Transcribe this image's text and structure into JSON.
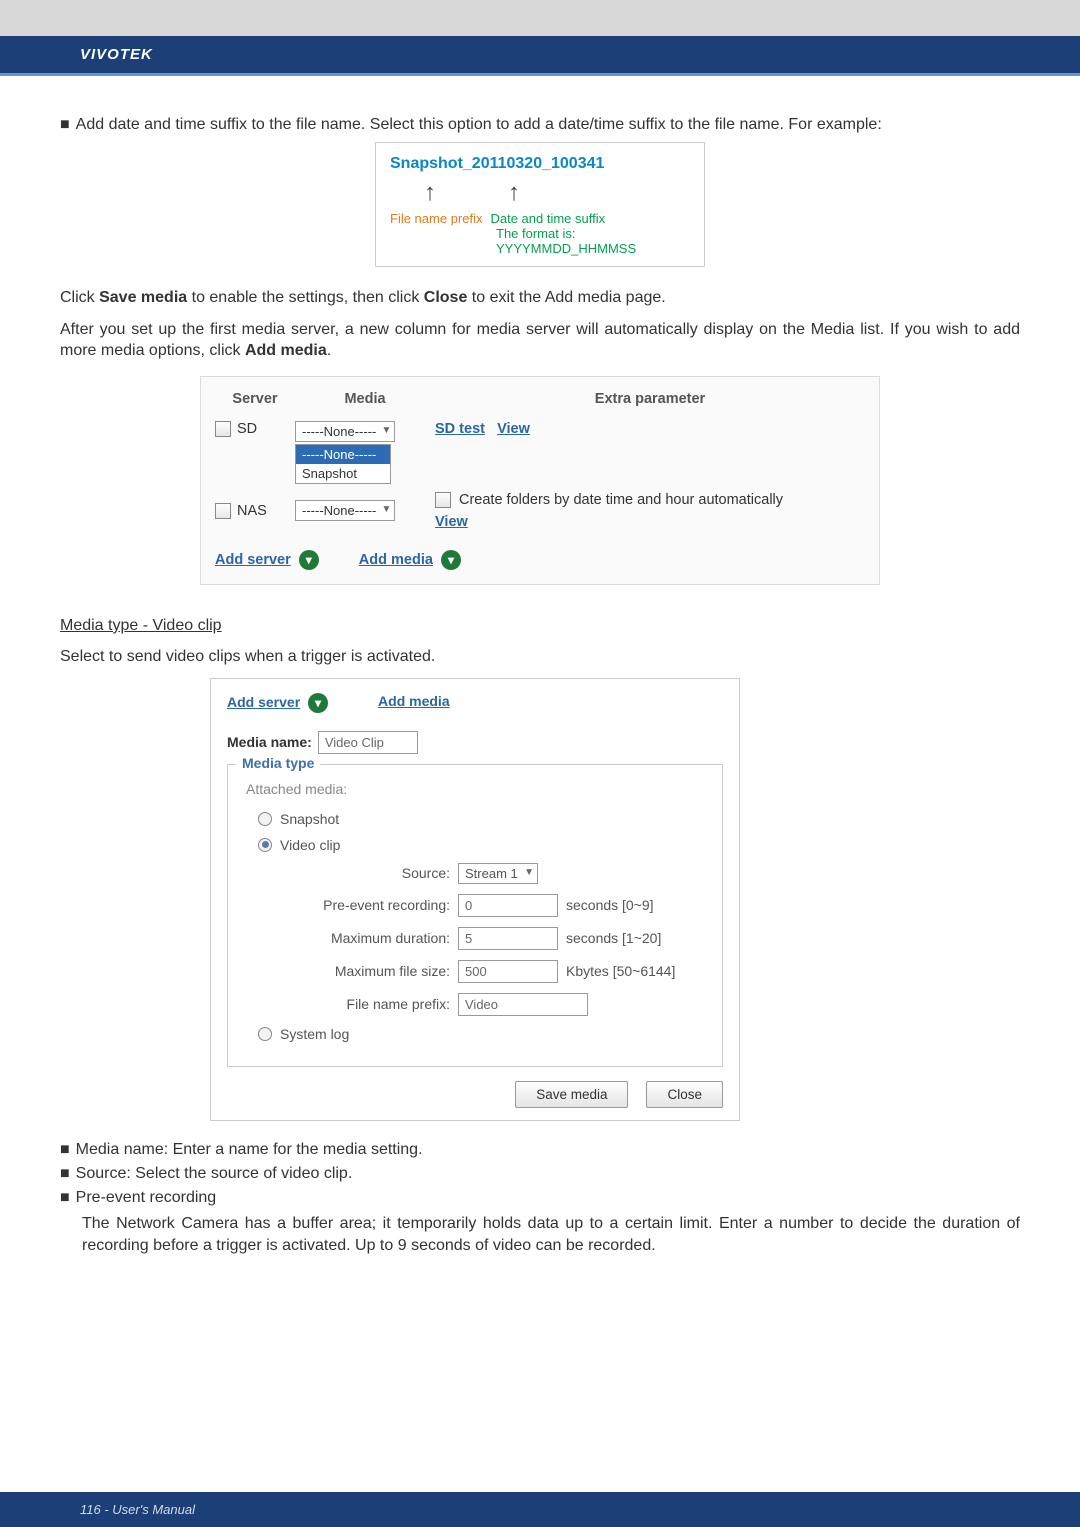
{
  "brand": "VIVOTEK",
  "intro_bullet": "Add date and time suffix to the file name. Select this option to add a date/time suffix to the file name. For example:",
  "example": {
    "filename": "Snapshot_20110320_100341",
    "prefix_label": "File name prefix",
    "suffix_label": "Date and time suffix",
    "format_label": "The format is: YYYYMMDD_HHMMSS"
  },
  "after_example_p1_a": "Click ",
  "after_example_p1_b": "Save media",
  "after_example_p1_c": " to enable the settings, then click ",
  "after_example_p1_d": "Close",
  "after_example_p1_e": " to exit the Add media page.",
  "after_example_p2_a": "After you set up the first media server, a new column for media server will automatically display on the Media list. If you wish to add more media options, click ",
  "after_example_p2_b": "Add media",
  "after_example_p2_c": ".",
  "table1": {
    "headers": {
      "server": "Server",
      "media": "Media",
      "extra": "Extra parameter"
    },
    "row_sd": {
      "label": "SD",
      "drop_value": "-----None-----",
      "drop_open_none": "-----None-----",
      "drop_open_snapshot": "Snapshot",
      "sd_test": "SD test",
      "view": "View"
    },
    "row_nas": {
      "label": "NAS",
      "drop_value": "-----None-----",
      "create_folders": "Create folders by date time and hour automatically",
      "view": "View"
    },
    "add_server": "Add server",
    "add_media": "Add media"
  },
  "media_type_heading": "Media type - Video clip",
  "media_type_desc": "Select to send video clips when a trigger is activated.",
  "panel2": {
    "add_server": "Add server",
    "add_media": "Add media",
    "media_name_label": "Media name:",
    "media_name_value": "Video Clip",
    "fieldset_legend": "Media type",
    "attached_media": "Attached media:",
    "opt_snapshot": "Snapshot",
    "opt_video": "Video clip",
    "opt_syslog": "System log",
    "source_label": "Source:",
    "source_value": "Stream 1",
    "pre_event_label": "Pre-event recording:",
    "pre_event_value": "0",
    "pre_event_hint": "seconds [0~9]",
    "max_dur_label": "Maximum duration:",
    "max_dur_value": "5",
    "max_dur_hint": "seconds [1~20]",
    "max_size_label": "Maximum file size:",
    "max_size_value": "500",
    "max_size_hint": "Kbytes [50~6144]",
    "prefix_label": "File name prefix:",
    "prefix_value": "Video",
    "btn_save": "Save media",
    "btn_close": "Close"
  },
  "bottomlist": {
    "b1": "Media name: Enter a name for the media setting.",
    "b2": "Source: Select the source of video clip.",
    "b3": "Pre-event recording",
    "b3_desc": "The Network Camera has a buffer area; it temporarily holds data up to a certain limit. Enter a number to decide the duration of recording before a trigger is activated. Up to 9 seconds of video can be recorded."
  },
  "footer": "116 - User's Manual"
}
